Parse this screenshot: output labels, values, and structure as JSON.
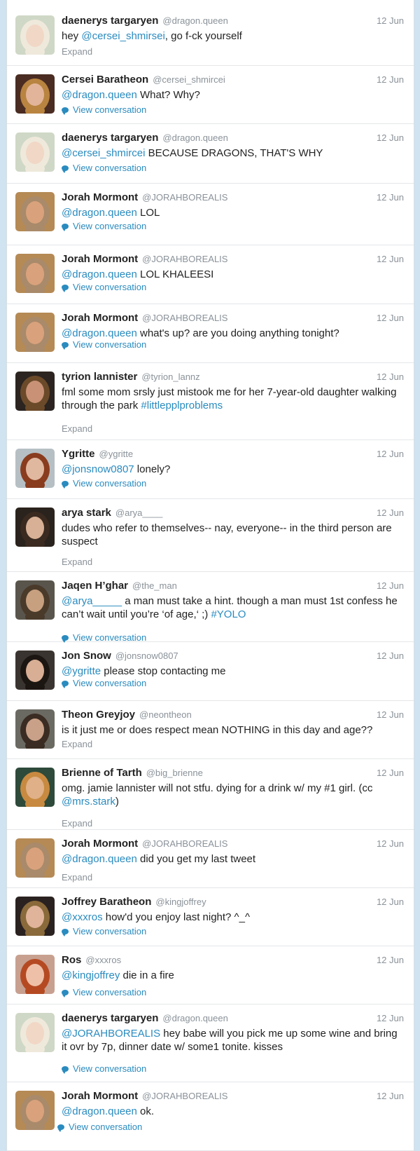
{
  "tweets": [
    {
      "name": "daenerys targaryen",
      "handle": "@dragon.queen",
      "time": "12 Jun",
      "segments": [
        {
          "t": "hey "
        },
        {
          "t": "@cersei_shmirsei",
          "m": true
        },
        {
          "t": ", go f-ck yourself"
        }
      ],
      "action": "Expand",
      "avatar": {
        "skin": "#f1d7c5",
        "hair": "#efe9dc",
        "bg": "#cfd8c6"
      }
    },
    {
      "name": "Cersei Baratheon",
      "handle": "@cersei_shmircei",
      "time": "12 Jun",
      "segments": [
        {
          "t": "@dragon.queen",
          "m": true
        },
        {
          "t": " What? Why?"
        }
      ],
      "action": "View conversation",
      "avatar": {
        "skin": "#e2b59a",
        "hair": "#b98440",
        "bg": "#4a2c22"
      }
    },
    {
      "name": "daenerys targaryen",
      "handle": "@dragon.queen",
      "time": "12 Jun",
      "segments": [
        {
          "t": "@cersei_shmircei",
          "m": true
        },
        {
          "t": " BECAUSE DRAGONS, THAT'S WHY"
        }
      ],
      "action": "View conversation",
      "avatar": {
        "skin": "#f1d7c5",
        "hair": "#efe9dc",
        "bg": "#cfd8c6"
      }
    },
    {
      "name": "Jorah Mormont",
      "handle": "@JORAHBOREALIS",
      "time": "12 Jun",
      "segments": [
        {
          "t": "@dragon.queen",
          "m": true
        },
        {
          "t": " LOL"
        }
      ],
      "action": "View conversation",
      "avatar": {
        "skin": "#d9a27c",
        "hair": "#a98a6a",
        "bg": "#b58a55"
      }
    },
    {
      "name": "Jorah Mormont",
      "handle": "@JORAHBOREALIS",
      "time": "12 Jun",
      "segments": [
        {
          "t": "@dragon.queen",
          "m": true
        },
        {
          "t": " LOL KHALEESI"
        }
      ],
      "action": "View conversation",
      "avatar": {
        "skin": "#d9a27c",
        "hair": "#a98a6a",
        "bg": "#b58a55"
      }
    },
    {
      "name": "Jorah Mormont",
      "handle": "@JORAHBOREALIS",
      "time": "12 Jun",
      "segments": [
        {
          "t": "@dragon.queen",
          "m": true
        },
        {
          "t": " what's up? are you doing anything tonight?"
        }
      ],
      "action": "View conversation",
      "avatar": {
        "skin": "#d9a27c",
        "hair": "#a98a6a",
        "bg": "#b58a55"
      }
    },
    {
      "name": "tyrion lannister",
      "handle": "@tyrion_lannz",
      "time": "12 Jun",
      "segments": [
        {
          "t": "fml some mom srsly just mistook me for her 7-year-old daughter walking through the park "
        },
        {
          "t": "#littlepplproblems",
          "m": true
        }
      ],
      "action": "Expand",
      "avatar": {
        "skin": "#c99276",
        "hair": "#6b4a2a",
        "bg": "#2b2420"
      }
    },
    {
      "name": "Ygritte",
      "handle": "@ygritte",
      "time": "12 Jun",
      "segments": [
        {
          "t": "@jonsnow0807",
          "m": true
        },
        {
          "t": " lonely?"
        }
      ],
      "action": "View conversation",
      "avatar": {
        "skin": "#e0b8a0",
        "hair": "#8a3c1e",
        "bg": "#b6c0c4"
      }
    },
    {
      "name": "arya stark",
      "handle": "@arya____",
      "time": "12 Jun",
      "segments": [
        {
          "t": "dudes who refer to themselves-- nay, everyone-- in the third person are suspect"
        }
      ],
      "action": "Expand",
      "avatar": {
        "skin": "#d8b095",
        "hair": "#3a2a20",
        "bg": "#2a221c"
      }
    },
    {
      "name": "Jaqen H’ghar",
      "handle": "@the_man",
      "time": "12 Jun",
      "segments": [
        {
          "t": " "
        },
        {
          "t": "@arya_____",
          "m": true
        },
        {
          "t": " a man must take a hint. though a man must 1st confess he can’t wait until you’re ‘of age,‘ ;) "
        },
        {
          "t": "#YOLO",
          "m": true
        }
      ],
      "action": "View conversation",
      "avatar": {
        "skin": "#c7a080",
        "hair": "#4a3a2a",
        "bg": "#5a554c"
      }
    },
    {
      "name": "Jon Snow",
      "handle": "@jonsnow0807",
      "time": "12 Jun",
      "segments": [
        {
          "t": "@ygritte",
          "m": true
        },
        {
          "t": " please stop contacting me"
        }
      ],
      "action": "View conversation",
      "avatar": {
        "skin": "#d8ae94",
        "hair": "#1c1612",
        "bg": "#3a3430"
      }
    },
    {
      "name": "Theon Greyjoy",
      "handle": "@neontheon",
      "time": "12 Jun",
      "segments": [
        {
          "t": "is it just me or does respect mean NOTHING in this day and age??"
        }
      ],
      "action": "Expand",
      "avatar": {
        "skin": "#c9a088",
        "hair": "#3a2c22",
        "bg": "#6b6a62"
      }
    },
    {
      "name": "Brienne of Tarth",
      "handle": "@big_brienne",
      "time": "12 Jun",
      "segments": [
        {
          "t": "omg. jamie lannister will not stfu. dying for a drink w/ my #1 girl. (cc "
        },
        {
          "t": "@mrs.stark",
          "m": true
        },
        {
          "t": ")"
        }
      ],
      "action": "Expand",
      "avatar": {
        "skin": "#e0b088",
        "hair": "#c88a40",
        "bg": "#2e4a3a"
      }
    },
    {
      "name": "Jorah Mormont",
      "handle": "@JORAHBOREALIS",
      "time": "12 Jun",
      "segments": [
        {
          "t": "@dragon.queen",
          "m": true
        },
        {
          "t": " did you get my last tweet"
        }
      ],
      "action": "Expand",
      "avatar": {
        "skin": "#d9a27c",
        "hair": "#a98a6a",
        "bg": "#b58a55"
      }
    },
    {
      "name": "Joffrey Baratheon",
      "handle": "@kingjoffrey",
      "time": "12 Jun",
      "segments": [
        {
          "t": "@xxxros",
          "m": true
        },
        {
          "t": " how'd you enjoy last night? ^_^"
        }
      ],
      "action": "View conversation",
      "avatar": {
        "skin": "#e0b49a",
        "hair": "#8a6a3a",
        "bg": "#2a2220"
      }
    },
    {
      "name": "Ros",
      "handle": "@xxxros",
      "time": "12 Jun",
      "segments": [
        {
          "t": "@kingjoffrey",
          "m": true
        },
        {
          "t": " die in a fire"
        }
      ],
      "action": "View conversation",
      "avatar": {
        "skin": "#efc0a8",
        "hair": "#b54a22",
        "bg": "#c8a090"
      }
    },
    {
      "name": "daenerys targaryen",
      "handle": "@dragon.queen",
      "time": "12 Jun",
      "segments": [
        {
          "t": "@JORAHBOREALIS",
          "m": true
        },
        {
          "t": " hey babe will you pick me up some wine and bring it ovr by 7p, dinner date w/ some1 tonite. kisses"
        }
      ],
      "action": "View conversation",
      "avatar": {
        "skin": "#f1d7c5",
        "hair": "#efe9dc",
        "bg": "#cfd8c6"
      }
    },
    {
      "name": "Jorah Mormont",
      "handle": "@JORAHBOREALIS",
      "time": "12 Jun",
      "segments": [
        {
          "t": "@dragon.queen",
          "m": true
        },
        {
          "t": " ok."
        }
      ],
      "action": "View conversation",
      "avatar": {
        "skin": "#d9a27c",
        "hair": "#a98a6a",
        "bg": "#b58a55"
      }
    }
  ]
}
